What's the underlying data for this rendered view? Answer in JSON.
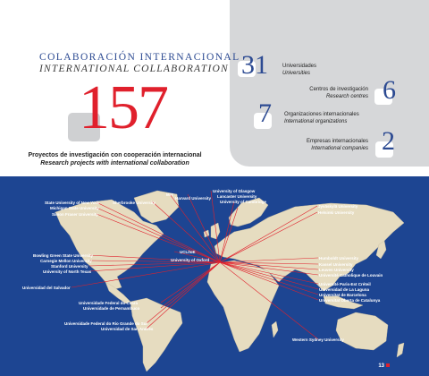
{
  "header": {
    "title_es": "COLABORACIÓN INTERNACIONAL",
    "title_en": "INTERNATIONAL COLLABORATION"
  },
  "projects": {
    "value": "157",
    "label_es": "Proyectos de investigación con cooperación internacional",
    "label_en": "Research projects with international collaboration"
  },
  "stats": [
    {
      "value": "31",
      "label_es": "Universidades",
      "label_en": "Universities"
    },
    {
      "value": "6",
      "label_es": "Centros de investigación",
      "label_en": "Research centres"
    },
    {
      "value": "7",
      "label_es": "Organizaciones internacionales",
      "label_en": "International organizations"
    },
    {
      "value": "2",
      "label_es": "Empresas internacionales",
      "label_en": "International companies"
    }
  ],
  "map": {
    "labels": {
      "state_ny": "State University of New York",
      "michigan": "Michigan State University",
      "simon_fraser": "Simon Fraser University",
      "sherbrooke": "Sherbrooke University",
      "mit": "MIT",
      "harvard": "Harvard University",
      "glasgow": "University of Glasgow",
      "lancaster": "Lancaster University",
      "cambridge": "University of Cambridge",
      "jyvaskyla": "Jyväskylä University",
      "helsinki": "Helsinki University",
      "bowling": "Bowling Green State University",
      "carnegie": "Carnegie Mellon University",
      "stanford": "Stanford University",
      "north_texas": "University of North Texas",
      "ucl": "UCL/IoE",
      "oxford": "University of Oxford",
      "humboldt": "Humboldt University",
      "kassel": "Kassel University",
      "leuven": "Leuven University",
      "louvain": "Université Catholique de Louvain",
      "el_salvador": "Universidad del Salvador",
      "paris": "Université Paris-Est Créteil",
      "laguna": "Universidad de La Laguna",
      "barcelona": "Universitat de Barcelona",
      "catalunya": "Universitat Oberta de Catalunya",
      "ceara": "Universidade Federal do Ceará",
      "pernambuco": "Universidade de Pernambuco",
      "rio_grande": "Universidade Federal do Rio Grande do Sul",
      "san_andres": "Universidad de San Andrés",
      "western_sydney": "Western Sydney University"
    },
    "page_number": "13"
  },
  "colors": {
    "accent_red": "#e0202c",
    "brand_blue": "#2c4a92",
    "map_bg": "#1d4592",
    "land": "#e6dcc0",
    "panel_grey": "#d6d7d9"
  }
}
